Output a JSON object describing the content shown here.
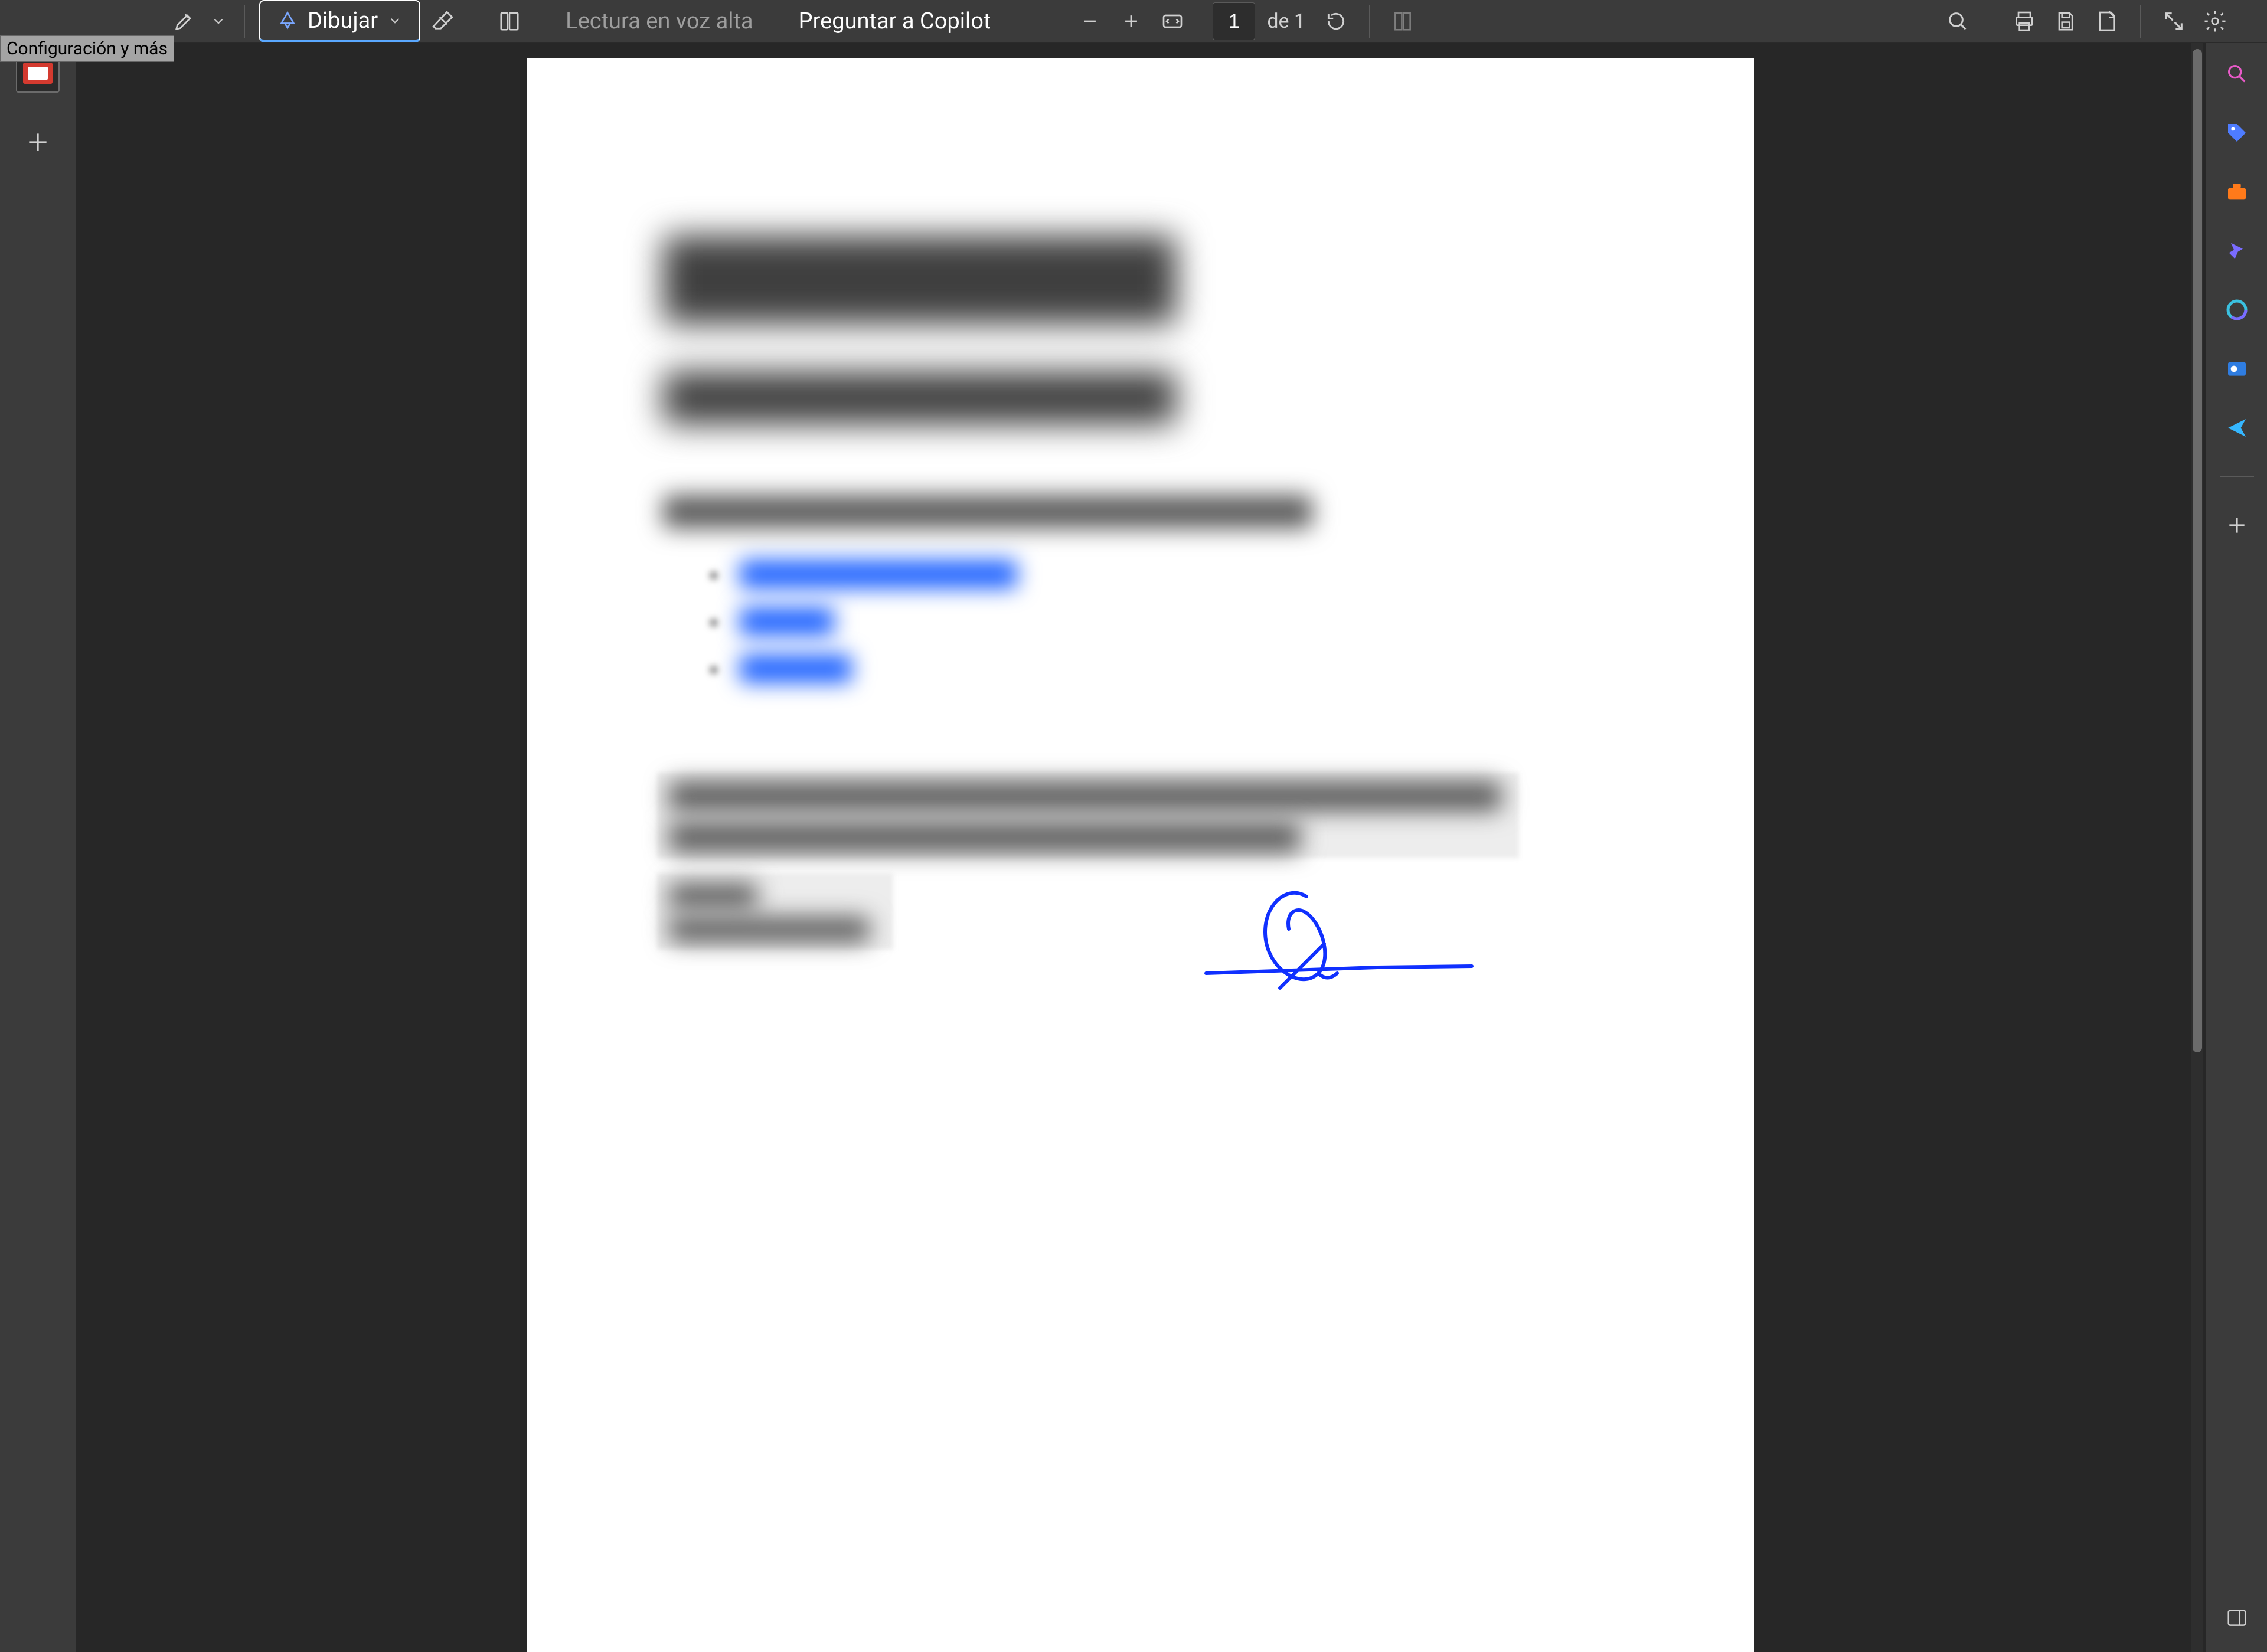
{
  "config_tooltip": "Configuración y más",
  "toolbar": {
    "draw_label": "Dibujar",
    "read_aloud": "Lectura en voz alta",
    "copilot_ask": "Preguntar a Copilot",
    "page_current": "1",
    "page_of": "de 1"
  },
  "sidebar_right": {
    "items": [
      "search",
      "tag",
      "toolbox",
      "wizard",
      "copilot",
      "camera",
      "send",
      "add",
      "split"
    ]
  },
  "left_rail": {
    "tabs": [
      "pdf-thumb"
    ],
    "add_tab": "+"
  },
  "signature_color": "#1030ff"
}
